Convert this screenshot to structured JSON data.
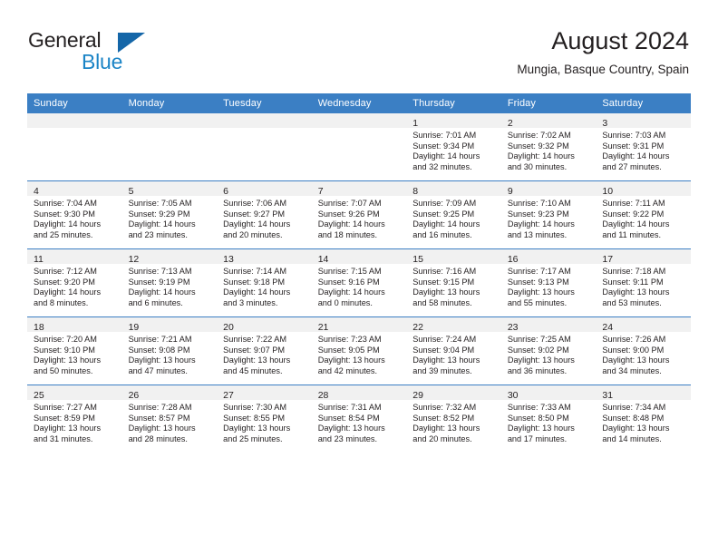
{
  "brand": {
    "word_general": "General",
    "word_blue": "Blue",
    "triangle_icon": "triangle-icon",
    "accent_color": "#1466a8"
  },
  "header": {
    "title": "August 2024",
    "subtitle": "Mungia, Basque Country, Spain"
  },
  "calendar": {
    "header_bg": "#3b7fc4",
    "daynum_bg": "#f1f1f1",
    "weekday_headers": [
      "Sunday",
      "Monday",
      "Tuesday",
      "Wednesday",
      "Thursday",
      "Friday",
      "Saturday"
    ],
    "weeks": [
      [
        {
          "day": "",
          "lines": []
        },
        {
          "day": "",
          "lines": []
        },
        {
          "day": "",
          "lines": []
        },
        {
          "day": "",
          "lines": []
        },
        {
          "day": "1",
          "lines": [
            "Sunrise: 7:01 AM",
            "Sunset: 9:34 PM",
            "Daylight: 14 hours",
            "and 32 minutes."
          ]
        },
        {
          "day": "2",
          "lines": [
            "Sunrise: 7:02 AM",
            "Sunset: 9:32 PM",
            "Daylight: 14 hours",
            "and 30 minutes."
          ]
        },
        {
          "day": "3",
          "lines": [
            "Sunrise: 7:03 AM",
            "Sunset: 9:31 PM",
            "Daylight: 14 hours",
            "and 27 minutes."
          ]
        }
      ],
      [
        {
          "day": "4",
          "lines": [
            "Sunrise: 7:04 AM",
            "Sunset: 9:30 PM",
            "Daylight: 14 hours",
            "and 25 minutes."
          ]
        },
        {
          "day": "5",
          "lines": [
            "Sunrise: 7:05 AM",
            "Sunset: 9:29 PM",
            "Daylight: 14 hours",
            "and 23 minutes."
          ]
        },
        {
          "day": "6",
          "lines": [
            "Sunrise: 7:06 AM",
            "Sunset: 9:27 PM",
            "Daylight: 14 hours",
            "and 20 minutes."
          ]
        },
        {
          "day": "7",
          "lines": [
            "Sunrise: 7:07 AM",
            "Sunset: 9:26 PM",
            "Daylight: 14 hours",
            "and 18 minutes."
          ]
        },
        {
          "day": "8",
          "lines": [
            "Sunrise: 7:09 AM",
            "Sunset: 9:25 PM",
            "Daylight: 14 hours",
            "and 16 minutes."
          ]
        },
        {
          "day": "9",
          "lines": [
            "Sunrise: 7:10 AM",
            "Sunset: 9:23 PM",
            "Daylight: 14 hours",
            "and 13 minutes."
          ]
        },
        {
          "day": "10",
          "lines": [
            "Sunrise: 7:11 AM",
            "Sunset: 9:22 PM",
            "Daylight: 14 hours",
            "and 11 minutes."
          ]
        }
      ],
      [
        {
          "day": "11",
          "lines": [
            "Sunrise: 7:12 AM",
            "Sunset: 9:20 PM",
            "Daylight: 14 hours",
            "and 8 minutes."
          ]
        },
        {
          "day": "12",
          "lines": [
            "Sunrise: 7:13 AM",
            "Sunset: 9:19 PM",
            "Daylight: 14 hours",
            "and 6 minutes."
          ]
        },
        {
          "day": "13",
          "lines": [
            "Sunrise: 7:14 AM",
            "Sunset: 9:18 PM",
            "Daylight: 14 hours",
            "and 3 minutes."
          ]
        },
        {
          "day": "14",
          "lines": [
            "Sunrise: 7:15 AM",
            "Sunset: 9:16 PM",
            "Daylight: 14 hours",
            "and 0 minutes."
          ]
        },
        {
          "day": "15",
          "lines": [
            "Sunrise: 7:16 AM",
            "Sunset: 9:15 PM",
            "Daylight: 13 hours",
            "and 58 minutes."
          ]
        },
        {
          "day": "16",
          "lines": [
            "Sunrise: 7:17 AM",
            "Sunset: 9:13 PM",
            "Daylight: 13 hours",
            "and 55 minutes."
          ]
        },
        {
          "day": "17",
          "lines": [
            "Sunrise: 7:18 AM",
            "Sunset: 9:11 PM",
            "Daylight: 13 hours",
            "and 53 minutes."
          ]
        }
      ],
      [
        {
          "day": "18",
          "lines": [
            "Sunrise: 7:20 AM",
            "Sunset: 9:10 PM",
            "Daylight: 13 hours",
            "and 50 minutes."
          ]
        },
        {
          "day": "19",
          "lines": [
            "Sunrise: 7:21 AM",
            "Sunset: 9:08 PM",
            "Daylight: 13 hours",
            "and 47 minutes."
          ]
        },
        {
          "day": "20",
          "lines": [
            "Sunrise: 7:22 AM",
            "Sunset: 9:07 PM",
            "Daylight: 13 hours",
            "and 45 minutes."
          ]
        },
        {
          "day": "21",
          "lines": [
            "Sunrise: 7:23 AM",
            "Sunset: 9:05 PM",
            "Daylight: 13 hours",
            "and 42 minutes."
          ]
        },
        {
          "day": "22",
          "lines": [
            "Sunrise: 7:24 AM",
            "Sunset: 9:04 PM",
            "Daylight: 13 hours",
            "and 39 minutes."
          ]
        },
        {
          "day": "23",
          "lines": [
            "Sunrise: 7:25 AM",
            "Sunset: 9:02 PM",
            "Daylight: 13 hours",
            "and 36 minutes."
          ]
        },
        {
          "day": "24",
          "lines": [
            "Sunrise: 7:26 AM",
            "Sunset: 9:00 PM",
            "Daylight: 13 hours",
            "and 34 minutes."
          ]
        }
      ],
      [
        {
          "day": "25",
          "lines": [
            "Sunrise: 7:27 AM",
            "Sunset: 8:59 PM",
            "Daylight: 13 hours",
            "and 31 minutes."
          ]
        },
        {
          "day": "26",
          "lines": [
            "Sunrise: 7:28 AM",
            "Sunset: 8:57 PM",
            "Daylight: 13 hours",
            "and 28 minutes."
          ]
        },
        {
          "day": "27",
          "lines": [
            "Sunrise: 7:30 AM",
            "Sunset: 8:55 PM",
            "Daylight: 13 hours",
            "and 25 minutes."
          ]
        },
        {
          "day": "28",
          "lines": [
            "Sunrise: 7:31 AM",
            "Sunset: 8:54 PM",
            "Daylight: 13 hours",
            "and 23 minutes."
          ]
        },
        {
          "day": "29",
          "lines": [
            "Sunrise: 7:32 AM",
            "Sunset: 8:52 PM",
            "Daylight: 13 hours",
            "and 20 minutes."
          ]
        },
        {
          "day": "30",
          "lines": [
            "Sunrise: 7:33 AM",
            "Sunset: 8:50 PM",
            "Daylight: 13 hours",
            "and 17 minutes."
          ]
        },
        {
          "day": "31",
          "lines": [
            "Sunrise: 7:34 AM",
            "Sunset: 8:48 PM",
            "Daylight: 13 hours",
            "and 14 minutes."
          ]
        }
      ]
    ]
  }
}
